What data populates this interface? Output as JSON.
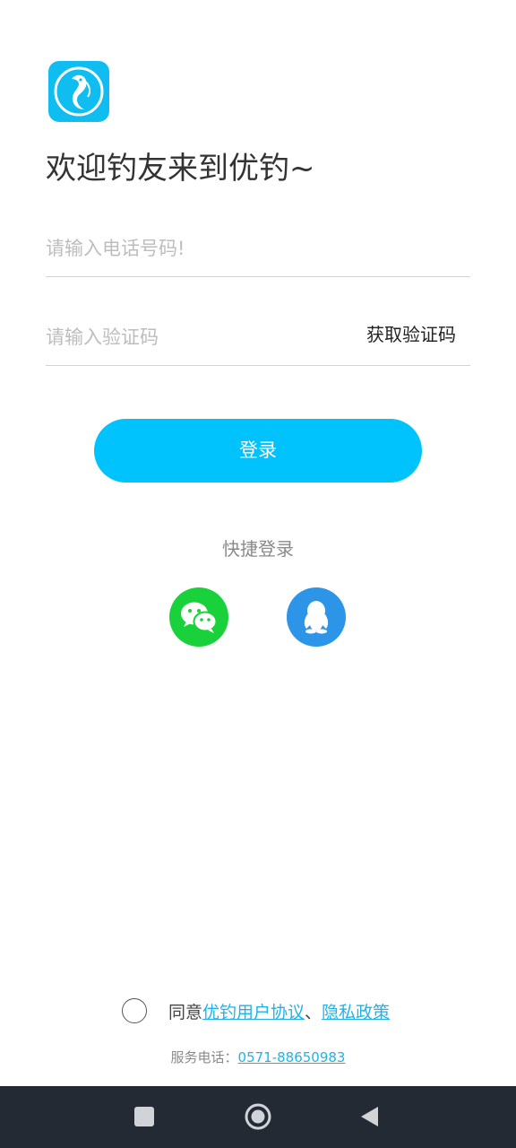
{
  "app": {
    "logo_icon": "fish-logo-icon",
    "brand_color": "#10bdf0"
  },
  "welcome": {
    "title": "欢迎钓友来到优钓~"
  },
  "form": {
    "phone_placeholder": "请输入电话号码!",
    "phone_value": "",
    "code_placeholder": "请输入验证码",
    "code_value": "",
    "get_code_label": "获取验证码",
    "login_label": "登录",
    "login_color": "#00c2fd"
  },
  "quick_login": {
    "label": "快捷登录",
    "options": [
      {
        "icon": "wechat-icon",
        "color": "#19d13a"
      },
      {
        "icon": "qq-icon",
        "color": "#2d95e8"
      }
    ]
  },
  "agreement": {
    "prefix": "同意",
    "user_agreement": "优钓用户协议",
    "separator": "、",
    "privacy_policy": "隐私政策",
    "checked": false,
    "link_color": "#1fb3e8"
  },
  "service": {
    "label": "服务电话：",
    "phone": "0571-88650983"
  },
  "nav_bar": {
    "buttons": [
      "recent-apps-icon",
      "home-icon",
      "back-icon"
    ]
  }
}
